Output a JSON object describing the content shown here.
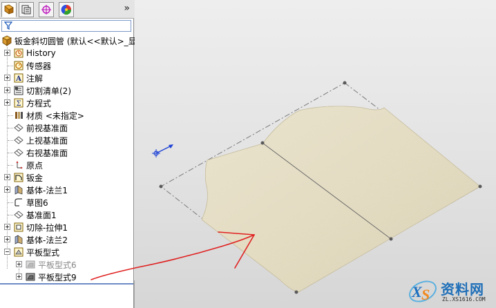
{
  "panel": {
    "tabs": [
      {
        "name": "feature-manager",
        "icon": "feature-tree-icon"
      },
      {
        "name": "property-manager",
        "icon": "property-manager-icon"
      },
      {
        "name": "configuration-manager",
        "icon": "configuration-icon"
      },
      {
        "name": "display-manager",
        "icon": "appearance-pie-icon"
      }
    ],
    "expand_glyph": "»",
    "filter_icon": "filter-funnel-icon"
  },
  "tree": {
    "root": "钣金斜切圆管  (默认<<默认>_显",
    "items": [
      {
        "label": "History",
        "icon": "history-icon"
      },
      {
        "label": "传感器",
        "icon": "sensor-icon"
      },
      {
        "label": "注解",
        "icon": "annotation-icon"
      },
      {
        "label": "切割清单(2)",
        "icon": "cut-list-icon"
      },
      {
        "label": "方程式",
        "icon": "equation-icon"
      },
      {
        "label": "材质 <未指定>",
        "icon": "material-icon"
      },
      {
        "label": "前视基准面",
        "icon": "plane-icon"
      },
      {
        "label": "上视基准面",
        "icon": "plane-icon"
      },
      {
        "label": "右视基准面",
        "icon": "plane-icon"
      },
      {
        "label": "原点",
        "icon": "origin-icon"
      },
      {
        "label": "钣金",
        "icon": "sheet-metal-icon"
      },
      {
        "label": "基体-法兰1",
        "icon": "base-flange-icon"
      },
      {
        "label": "草图6",
        "icon": "sketch-icon"
      },
      {
        "label": "基准面1",
        "icon": "plane-icon"
      },
      {
        "label": "切除-拉伸1",
        "icon": "cut-extrude-icon"
      },
      {
        "label": "基体-法兰2",
        "icon": "base-flange-icon"
      },
      {
        "label": "平板型式",
        "icon": "flat-pattern-folder-icon"
      }
    ],
    "children": [
      {
        "label": "平板型式6",
        "icon": "flat-pattern-icon"
      },
      {
        "label": "平板型式9",
        "icon": "flat-pattern-icon"
      }
    ]
  },
  "watermark": {
    "logo_letters": "XS",
    "text": "资料网",
    "url": "ZL.XS1616.COM"
  },
  "colors": {
    "sheet": "#e4dcc2",
    "annotation_arrow": "#e02020",
    "triad": "#1a3fd6"
  }
}
